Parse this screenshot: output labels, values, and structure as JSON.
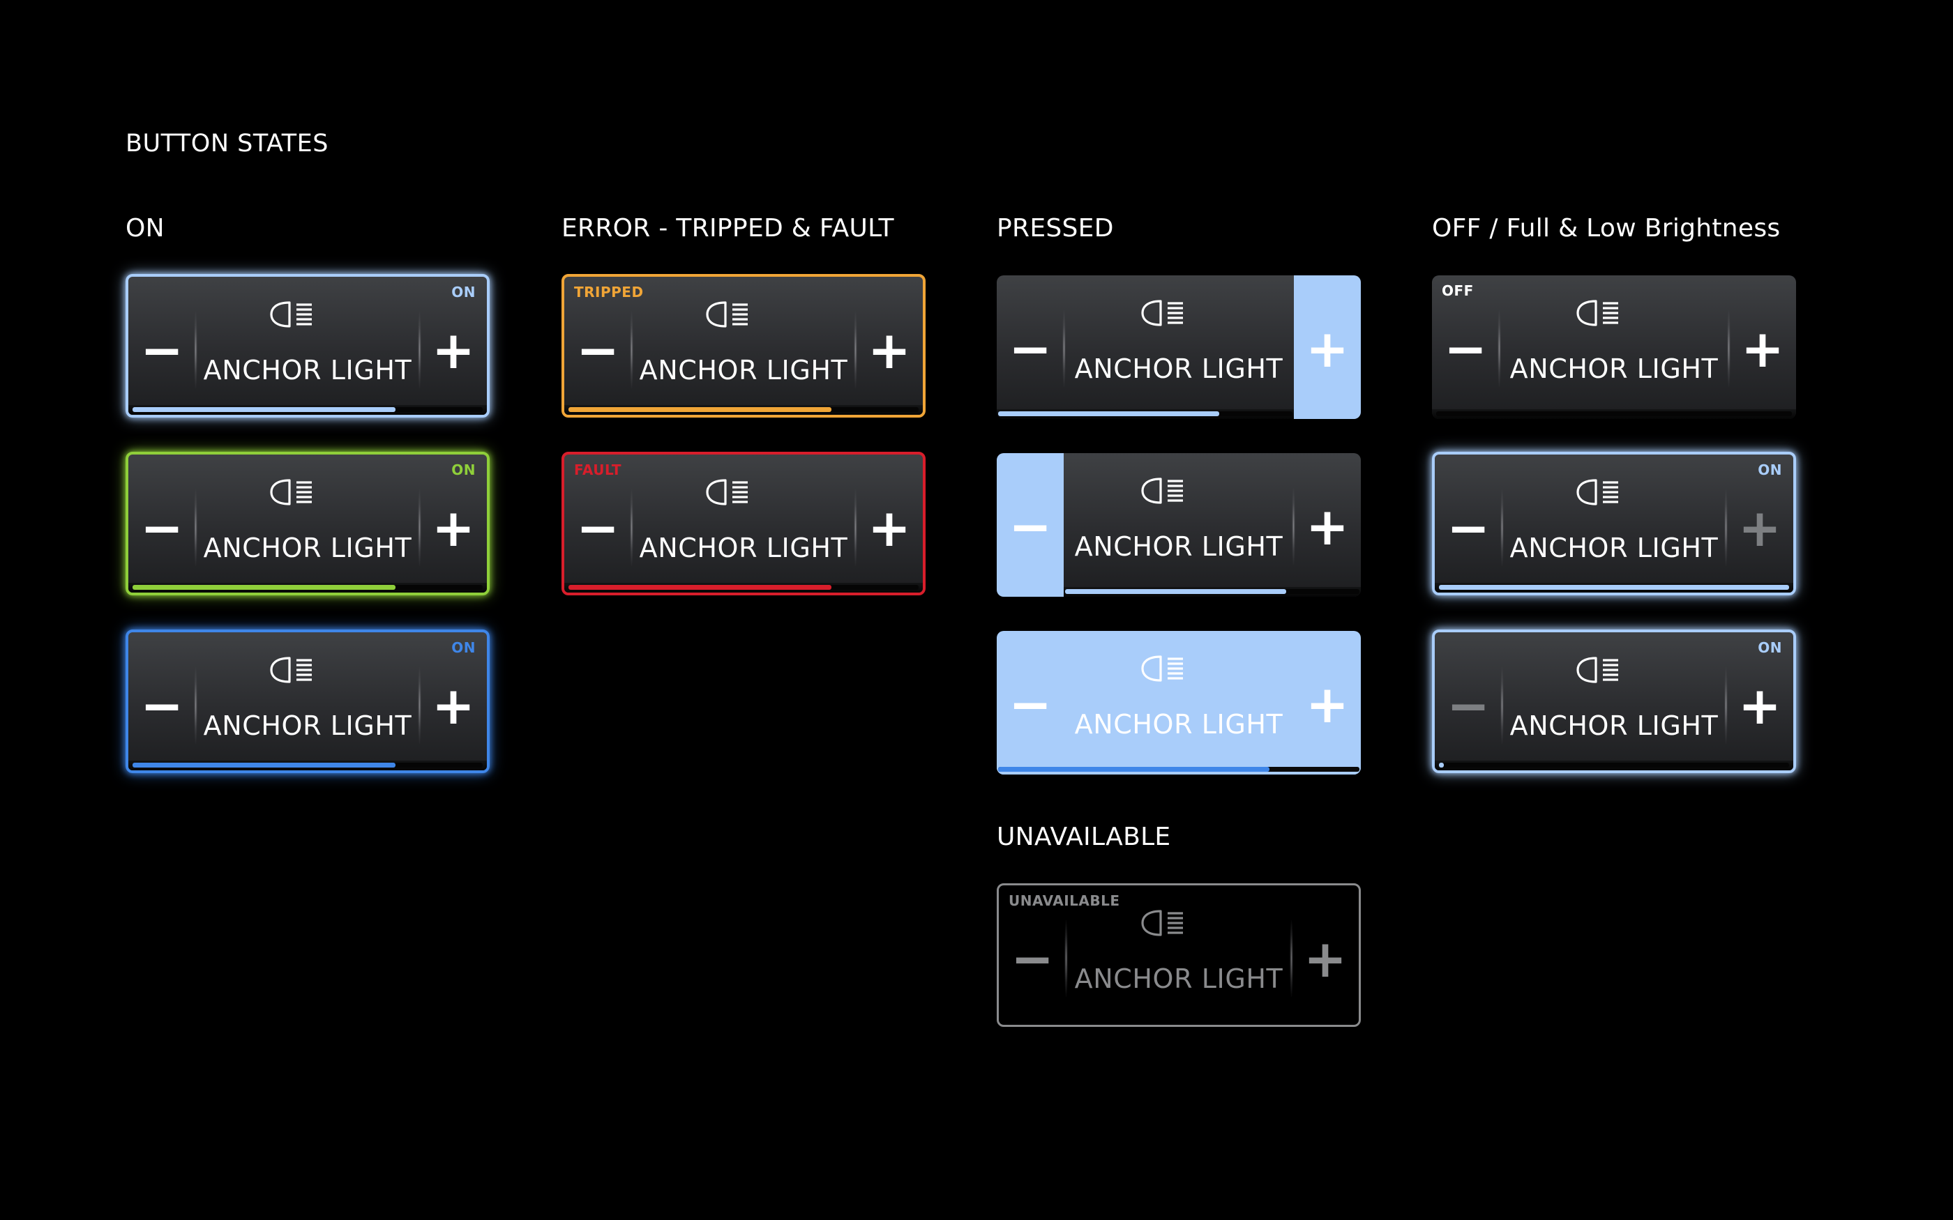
{
  "page": {
    "title": "BUTTON STATES"
  },
  "columns": [
    {
      "title": "ON"
    },
    {
      "title": "ERROR - TRIPPED & FAULT"
    },
    {
      "title": "PRESSED"
    },
    {
      "title": "OFF / Full & Low Brightness"
    }
  ],
  "unavailable_section": {
    "title": "UNAVAILABLE"
  },
  "button_label": "ANCHOR LIGHT",
  "minus_symbol": "−",
  "plus_symbol": "+",
  "icon": "headlight-icon",
  "colors": {
    "on_blue": "#a9cdfa",
    "on_green": "#8fcf3a",
    "on_deep_blue": "#3f86e8",
    "tripped": "#f0a537",
    "fault": "#d81e2b",
    "pressed": "#a9cdfa",
    "unavailable": "#8a8b8d"
  },
  "buttons": [
    {
      "id": "on-light-blue",
      "status": "ON",
      "brightness": 0.75
    },
    {
      "id": "on-green",
      "status": "ON",
      "brightness": 0.75
    },
    {
      "id": "on-blue",
      "status": "ON",
      "brightness": 0.75
    },
    {
      "id": "tripped",
      "status": "TRIPPED",
      "brightness": 0.75
    },
    {
      "id": "fault",
      "status": "FAULT",
      "brightness": 0.75
    },
    {
      "id": "pressed-plus",
      "status": "",
      "brightness": 0.75
    },
    {
      "id": "pressed-minus",
      "status": "",
      "brightness": 0.75
    },
    {
      "id": "pressed-full",
      "status": "",
      "brightness": 0.75
    },
    {
      "id": "off",
      "status": "OFF",
      "brightness": 0.0
    },
    {
      "id": "full-brightness",
      "status": "ON",
      "brightness": 1.0
    },
    {
      "id": "low-brightness",
      "status": "ON",
      "brightness": 0.01
    },
    {
      "id": "unavailable",
      "status": "UNAVAILABLE",
      "brightness": 0.0
    }
  ]
}
